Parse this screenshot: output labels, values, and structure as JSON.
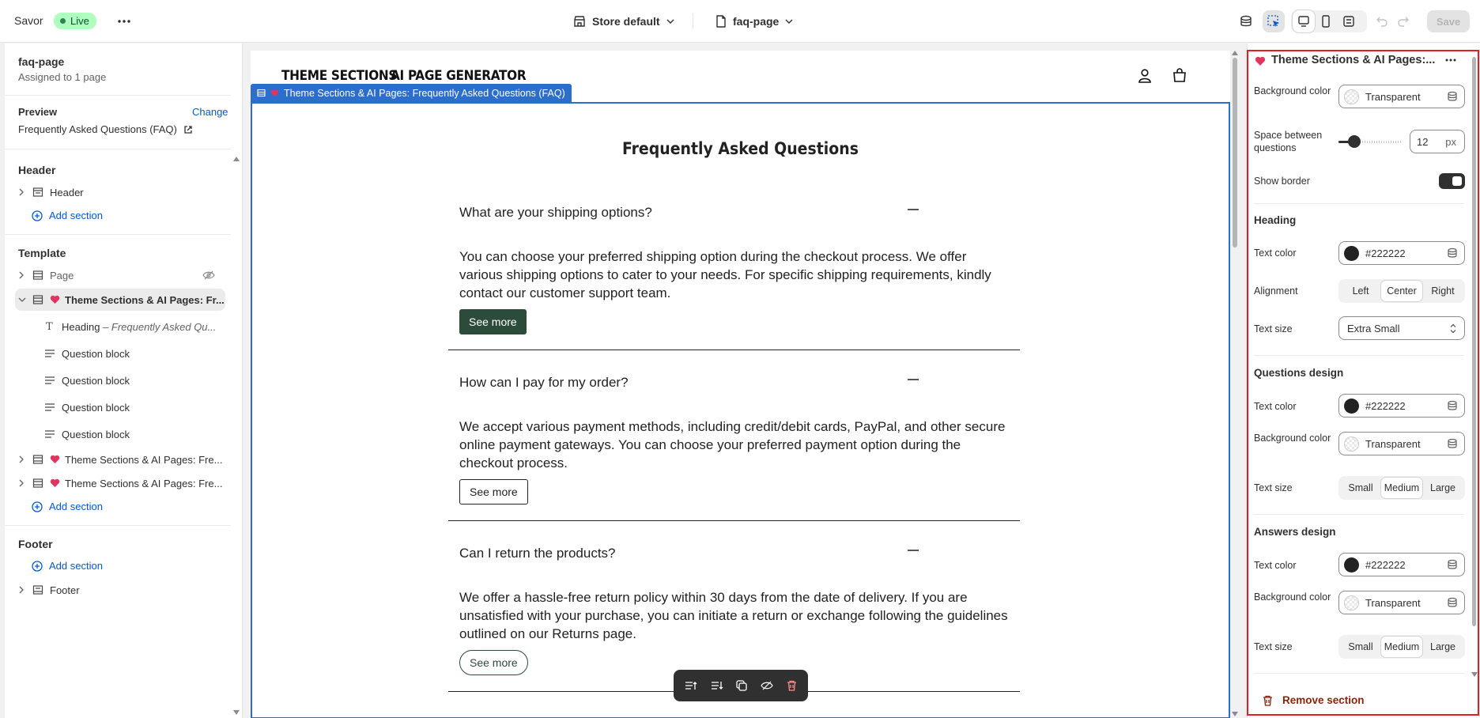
{
  "topbar": {
    "store_name": "Savor",
    "status": "Live",
    "theme_selector": "Store default",
    "template_selector": "faq-page",
    "save_label": "Save"
  },
  "sidebar": {
    "template_title": "faq-page",
    "assigned": "Assigned to 1 page",
    "preview_label": "Preview",
    "preview_change": "Change",
    "preview_page": "Frequently Asked Questions (FAQ)",
    "header_group": "Header",
    "header_item": "Header",
    "add_section": "Add section",
    "template_group": "Template",
    "page_item": "Page",
    "selected_section": "Theme Sections & AI Pages: Fr...",
    "heading_block": "Heading",
    "heading_block_sub": "– Frequently Asked Qu...",
    "question_blocks": [
      "Question block",
      "Question block",
      "Question block",
      "Question block"
    ],
    "other_sections": [
      "Theme Sections & AI Pages: Fre...",
      "Theme Sections & AI Pages: Fre..."
    ],
    "footer_group": "Footer",
    "footer_item": "Footer"
  },
  "store": {
    "logo_left": "THEME SECTIONS",
    "logo_right": "AI PAGE GENERATOR",
    "section_tag": "Theme Sections & AI Pages: Frequently Asked Questions (FAQ)",
    "faq_title": "Frequently Asked Questions",
    "faqs": [
      {
        "question": "What are your shipping options?",
        "answer": "You can choose your preferred shipping option during the checkout process. We offer various shipping options to cater to your needs. For specific shipping requirements, kindly contact our customer support team.",
        "button": "See more"
      },
      {
        "question": "How can I pay for my order?",
        "answer": "We accept various payment methods, including credit/debit cards, PayPal, and other secure online payment gateways. You can choose your preferred payment option during the checkout process.",
        "button": "See more"
      },
      {
        "question": "Can I return the products?",
        "answer": "We offer a hassle-free return policy within 30 days from the date of delivery. If you are unsatisfied with your purchase, you can initiate a return or exchange following the guidelines outlined on our Returns page.",
        "button": "See more"
      }
    ]
  },
  "panel": {
    "title": "Theme Sections & AI Pages:...",
    "background_color_label": "Background color",
    "background_color_value": "Transparent",
    "space_label": "Space between questions",
    "space_value": "12",
    "space_unit": "px",
    "space_fraction": 0.25,
    "show_border_label": "Show border",
    "heading_group": "Heading",
    "heading_text_color_label": "Text color",
    "heading_text_color_value": "#222222",
    "alignment_label": "Alignment",
    "alignment_options": [
      "Left",
      "Center",
      "Right"
    ],
    "alignment_selected": "Center",
    "heading_text_size_label": "Text size",
    "heading_text_size_value": "Extra Small",
    "questions_group": "Questions design",
    "questions_text_color_label": "Text color",
    "questions_text_color_value": "#222222",
    "questions_bg_label": "Background color",
    "questions_bg_value": "Transparent",
    "questions_size_label": "Text size",
    "size_options": [
      "Small",
      "Medium",
      "Large"
    ],
    "questions_size_selected": "Medium",
    "answers_group": "Answers design",
    "answers_text_color_label": "Text color",
    "answers_text_color_value": "#222222",
    "answers_bg_label": "Background color",
    "answers_bg_value": "Transparent",
    "answers_size_label": "Text size",
    "answers_size_selected": "Medium",
    "remove_label": "Remove section"
  },
  "colors": {
    "accent_blue": "#005bd3",
    "live_green": "#affebf",
    "button_dark_green": "#2c4b3a",
    "text_dark": "#222222",
    "remove_red": "#8e1f0b",
    "outline_red": "#e51c23"
  }
}
